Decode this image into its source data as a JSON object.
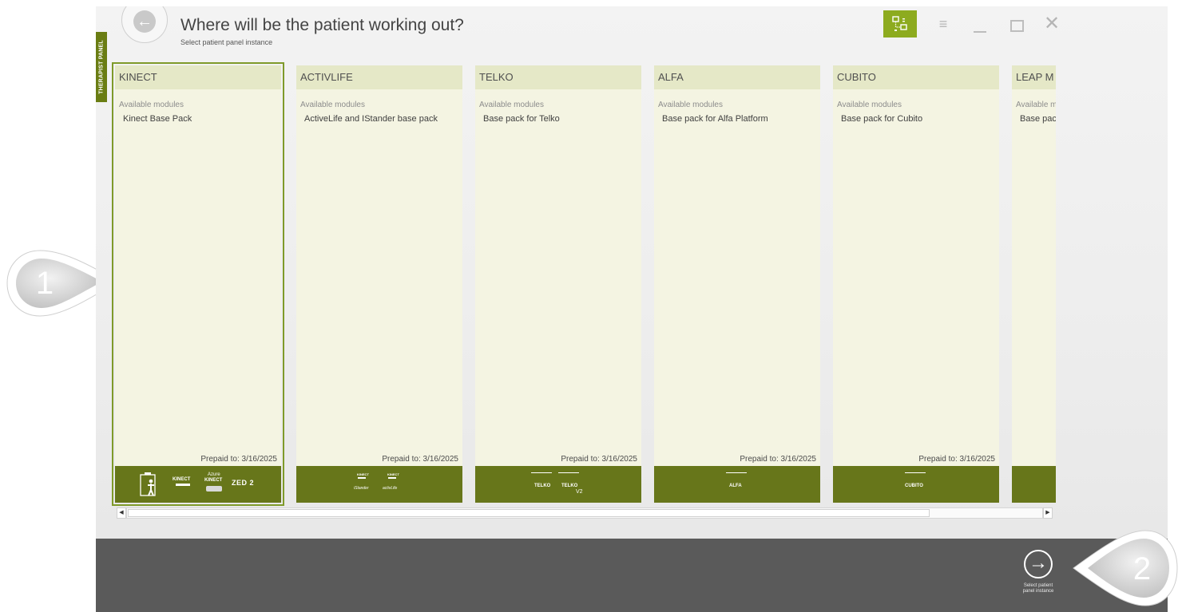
{
  "sidebar": {
    "tab_label": "THERAPIST PANEL"
  },
  "header": {
    "title": "Where will be the patient working out?",
    "subtitle": "Select patient panel instance"
  },
  "icons": {
    "back": "arrow-left-icon",
    "panel_toggle": "panel-network-icon",
    "settings": "sliders-icon",
    "minimize": "minimize-icon",
    "maximize": "maximize-icon",
    "close": "close-icon",
    "next": "arrow-right-icon"
  },
  "colors": {
    "accent": "#8dab1f",
    "card_footer": "#67761a",
    "card_body": "#f4f4e2",
    "card_header": "#e5e8c7",
    "bottom_bar": "#5a5a5a"
  },
  "cards": [
    {
      "name": "KINECT",
      "modules_label": "Available modules",
      "module": "Kinect Base Pack",
      "prepaid": "Prepaid to: 3/16/2025",
      "logos": [
        "KINECT",
        "Azure",
        "KINECT",
        "ZED 2"
      ]
    },
    {
      "name": "ACTIVLIFE",
      "modules_label": "Available modules",
      "module": "ActiveLife and IStander base pack",
      "prepaid": "Prepaid to: 3/16/2025",
      "logos": [
        "KINECT",
        "KINECT",
        "iStander",
        "activLife"
      ]
    },
    {
      "name": "TELKO",
      "modules_label": "Available modules",
      "module": "Base pack for Telko",
      "prepaid": "Prepaid to: 3/16/2025",
      "logos": [
        "TELKO",
        "TELKO",
        "V2"
      ]
    },
    {
      "name": "ALFA",
      "modules_label": "Available modules",
      "module": "Base pack for Alfa Platform",
      "prepaid": "Prepaid to: 3/16/2025",
      "logos": [
        "ALFA"
      ]
    },
    {
      "name": "CUBITO",
      "modules_label": "Available modules",
      "module": "Base pack for Cubito",
      "prepaid": "Prepaid to: 3/16/2025",
      "logos": [
        "CUBITO"
      ]
    },
    {
      "name": "LEAP M",
      "modules_label": "Available m",
      "module": "Base pacl",
      "prepaid": "",
      "logos": []
    }
  ],
  "footer": {
    "next_label": "Select patient panel instance"
  },
  "callouts": {
    "first": "1",
    "second": "2"
  }
}
